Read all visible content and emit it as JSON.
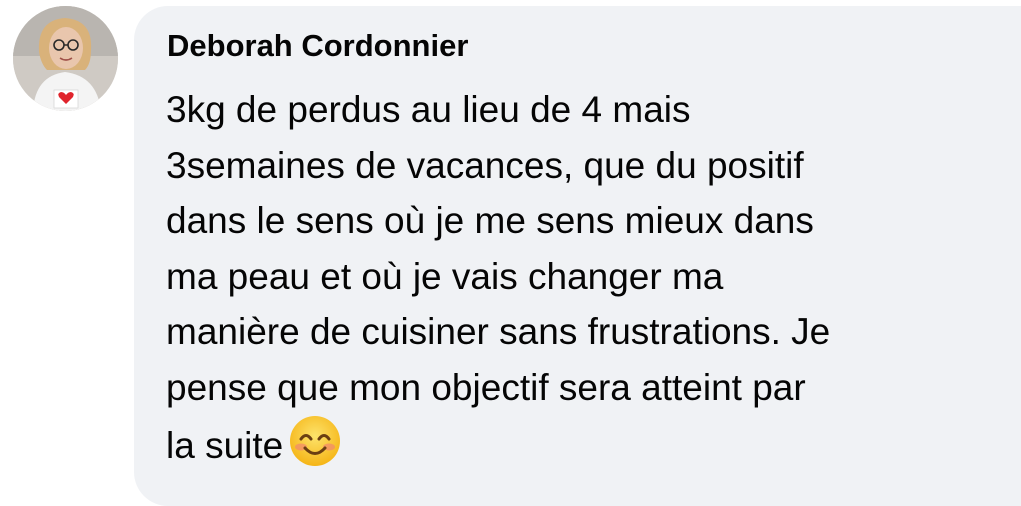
{
  "comment": {
    "author": "Deborah Cordonnier",
    "message_lines": [
      "3kg de perdus au lieu de 4 mais",
      "3semaines de vacances, que du positif",
      "dans le sens où je me sens mieux dans",
      "ma peau et où je vais changer ma",
      "manière de cuisiner sans frustrations. Je",
      "pense que mon objectif sera atteint par",
      "la suite"
    ],
    "emoji": "smiling-face-with-smiling-eyes",
    "colors": {
      "bubble_background": "#f0f2f5",
      "text": "#050505",
      "emoji_face": "#f9c22e"
    }
  }
}
